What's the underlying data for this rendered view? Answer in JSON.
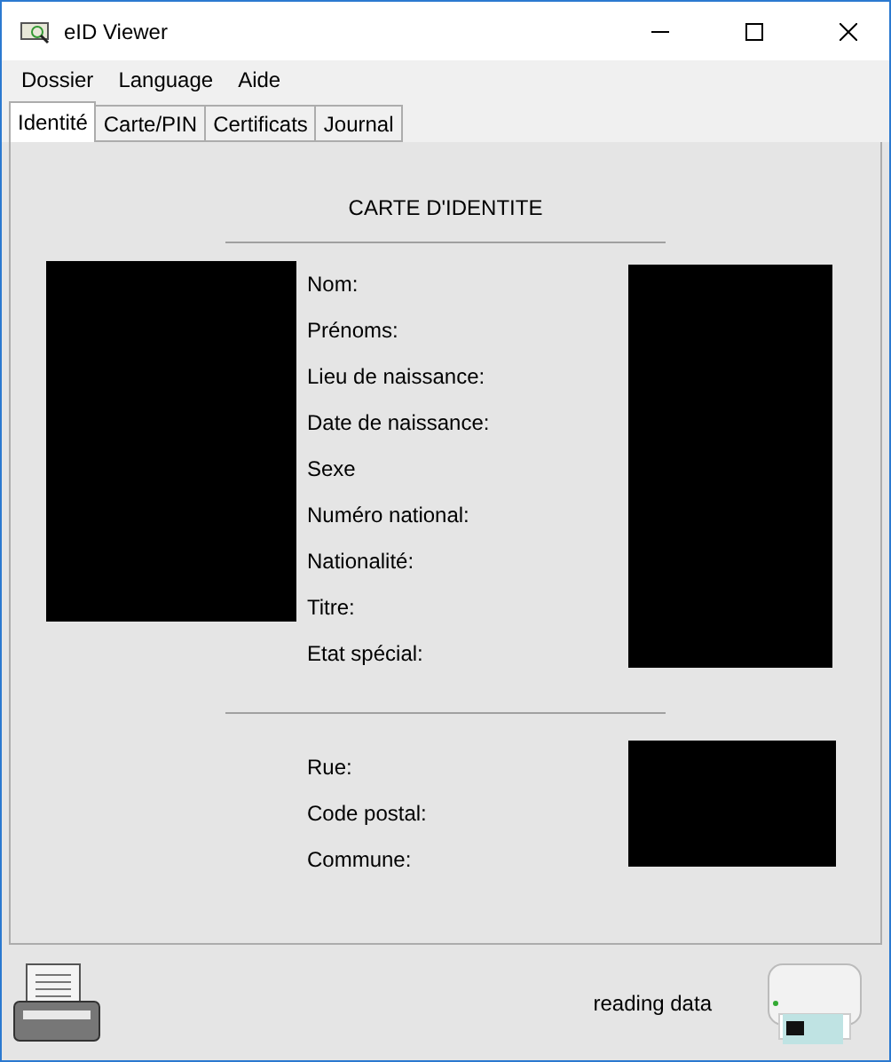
{
  "window": {
    "title": "eID Viewer"
  },
  "menu": [
    "Dossier",
    "Language",
    "Aide"
  ],
  "tabs": [
    {
      "label": "Identité",
      "selected": true
    },
    {
      "label": "Carte/PIN",
      "selected": false
    },
    {
      "label": "Certificats",
      "selected": false
    },
    {
      "label": "Journal",
      "selected": false
    }
  ],
  "card_title": "CARTE D'IDENTITE",
  "identity_fields": [
    "Nom:",
    "Prénoms:",
    "Lieu de naissance:",
    "Date de naissance:",
    "Sexe",
    "Numéro national:",
    "Nationalité:",
    "Titre:",
    "Etat spécial:"
  ],
  "address_fields": [
    "Rue:",
    "Code postal:",
    "Commune:"
  ],
  "status_bar": {
    "text": "reading data"
  }
}
